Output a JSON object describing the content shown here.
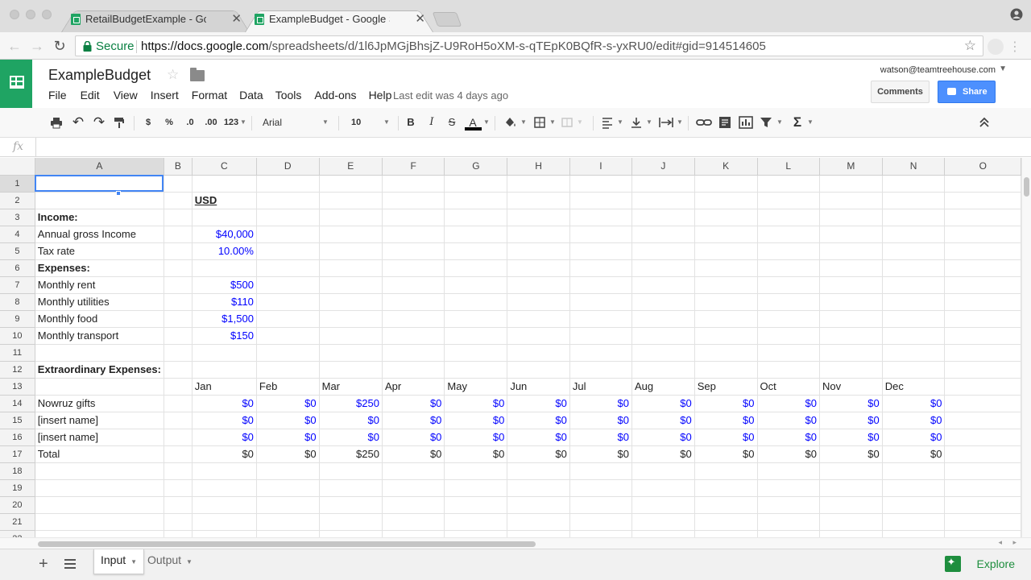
{
  "browser": {
    "tabs": [
      {
        "title": "RetailBudgetExample - Google",
        "active": false
      },
      {
        "title": "ExampleBudget - Google Shee",
        "active": true
      }
    ],
    "secure_label": "Secure",
    "url_host": "https://docs.google.com",
    "url_path": "/spreadsheets/d/1l6JpMGjBhsjZ-U9RoH5oXM-s-qTEpK0BQfR-s-yxRU0/edit#gid=914514605"
  },
  "doc": {
    "title": "ExampleBudget",
    "last_edit": "Last edit was 4 days ago",
    "menus": [
      "File",
      "Edit",
      "View",
      "Insert",
      "Format",
      "Data",
      "Tools",
      "Add-ons",
      "Help"
    ]
  },
  "account": {
    "email": "watson@teamtreehouse.com",
    "comments_label": "Comments",
    "share_label": "Share"
  },
  "toolbar": {
    "currency": "$",
    "percent": "%",
    "dec_less": ".0",
    "dec_more": ".00",
    "more_formats": "123",
    "font": "Arial",
    "font_size": "10",
    "bold": "B",
    "italic": "I",
    "strike": "S",
    "text_color": "A"
  },
  "formula_bar": {
    "label": "fx",
    "content": ""
  },
  "grid": {
    "columns": [
      "A",
      "B",
      "C",
      "D",
      "E",
      "F",
      "G",
      "H",
      "I",
      "J",
      "K",
      "L",
      "M",
      "N",
      "O"
    ],
    "rows": [
      {
        "n": "1",
        "cells": [
          "",
          "",
          "",
          "",
          "",
          "",
          "",
          "",
          "",
          "",
          "",
          "",
          "",
          "",
          ""
        ]
      },
      {
        "n": "2",
        "cells": [
          "",
          "",
          "USD",
          "",
          "",
          "",
          "",
          "",
          "",
          "",
          "",
          "",
          "",
          "",
          ""
        ]
      },
      {
        "n": "3",
        "cells": [
          "Income:",
          "",
          "",
          "",
          "",
          "",
          "",
          "",
          "",
          "",
          "",
          "",
          "",
          "",
          ""
        ]
      },
      {
        "n": "4",
        "cells": [
          "Annual gross Income",
          "",
          "$40,000",
          "",
          "",
          "",
          "",
          "",
          "",
          "",
          "",
          "",
          "",
          "",
          ""
        ]
      },
      {
        "n": "5",
        "cells": [
          "Tax rate",
          "",
          "10.00%",
          "",
          "",
          "",
          "",
          "",
          "",
          "",
          "",
          "",
          "",
          "",
          ""
        ]
      },
      {
        "n": "6",
        "cells": [
          "Expenses:",
          "",
          "",
          "",
          "",
          "",
          "",
          "",
          "",
          "",
          "",
          "",
          "",
          "",
          ""
        ]
      },
      {
        "n": "7",
        "cells": [
          "Monthly rent",
          "",
          "$500",
          "",
          "",
          "",
          "",
          "",
          "",
          "",
          "",
          "",
          "",
          "",
          ""
        ]
      },
      {
        "n": "8",
        "cells": [
          "Monthly utilities",
          "",
          "$110",
          "",
          "",
          "",
          "",
          "",
          "",
          "",
          "",
          "",
          "",
          "",
          ""
        ]
      },
      {
        "n": "9",
        "cells": [
          "Monthly food",
          "",
          "$1,500",
          "",
          "",
          "",
          "",
          "",
          "",
          "",
          "",
          "",
          "",
          "",
          ""
        ]
      },
      {
        "n": "10",
        "cells": [
          "Monthly transport",
          "",
          "$150",
          "",
          "",
          "",
          "",
          "",
          "",
          "",
          "",
          "",
          "",
          "",
          ""
        ]
      },
      {
        "n": "11",
        "cells": [
          "",
          "",
          "",
          "",
          "",
          "",
          "",
          "",
          "",
          "",
          "",
          "",
          "",
          "",
          ""
        ]
      },
      {
        "n": "12",
        "cells": [
          "Extraordinary Expenses:",
          "",
          "",
          "",
          "",
          "",
          "",
          "",
          "",
          "",
          "",
          "",
          "",
          "",
          ""
        ]
      },
      {
        "n": "13",
        "cells": [
          "",
          "",
          "Jan",
          "Feb",
          "Mar",
          "Apr",
          "May",
          "Jun",
          "Jul",
          "Aug",
          "Sep",
          "Oct",
          "Nov",
          "Dec",
          ""
        ]
      },
      {
        "n": "14",
        "cells": [
          "Nowruz gifts",
          "",
          "$0",
          "$0",
          "$250",
          "$0",
          "$0",
          "$0",
          "$0",
          "$0",
          "$0",
          "$0",
          "$0",
          "$0",
          ""
        ]
      },
      {
        "n": "15",
        "cells": [
          "[insert name]",
          "",
          "$0",
          "$0",
          "$0",
          "$0",
          "$0",
          "$0",
          "$0",
          "$0",
          "$0",
          "$0",
          "$0",
          "$0",
          ""
        ]
      },
      {
        "n": "16",
        "cells": [
          "[insert name]",
          "",
          "$0",
          "$0",
          "$0",
          "$0",
          "$0",
          "$0",
          "$0",
          "$0",
          "$0",
          "$0",
          "$0",
          "$0",
          ""
        ]
      },
      {
        "n": "17",
        "cells": [
          "Total",
          "",
          "$0",
          "$0",
          "$250",
          "$0",
          "$0",
          "$0",
          "$0",
          "$0",
          "$0",
          "$0",
          "$0",
          "$0",
          ""
        ]
      },
      {
        "n": "18",
        "cells": [
          "",
          "",
          "",
          "",
          "",
          "",
          "",
          "",
          "",
          "",
          "",
          "",
          "",
          "",
          ""
        ]
      },
      {
        "n": "19",
        "cells": [
          "",
          "",
          "",
          "",
          "",
          "",
          "",
          "",
          "",
          "",
          "",
          "",
          "",
          "",
          ""
        ]
      },
      {
        "n": "20",
        "cells": [
          "",
          "",
          "",
          "",
          "",
          "",
          "",
          "",
          "",
          "",
          "",
          "",
          "",
          "",
          ""
        ]
      },
      {
        "n": "21",
        "cells": [
          "",
          "",
          "",
          "",
          "",
          "",
          "",
          "",
          "",
          "",
          "",
          "",
          "",
          "",
          ""
        ]
      },
      {
        "n": "22",
        "cells": [
          "",
          "",
          "",
          "",
          "",
          "",
          "",
          "",
          "",
          "",
          "",
          "",
          "",
          "",
          ""
        ]
      }
    ]
  },
  "sheet_tabs": [
    {
      "label": "Input",
      "active": true
    },
    {
      "label": "Output",
      "active": false
    }
  ],
  "explore_label": "Explore",
  "colors": {
    "accent": "#4285f4",
    "share": "#4d90fe",
    "sheets_green": "#1fa463",
    "value_blue": "#0000ff"
  }
}
